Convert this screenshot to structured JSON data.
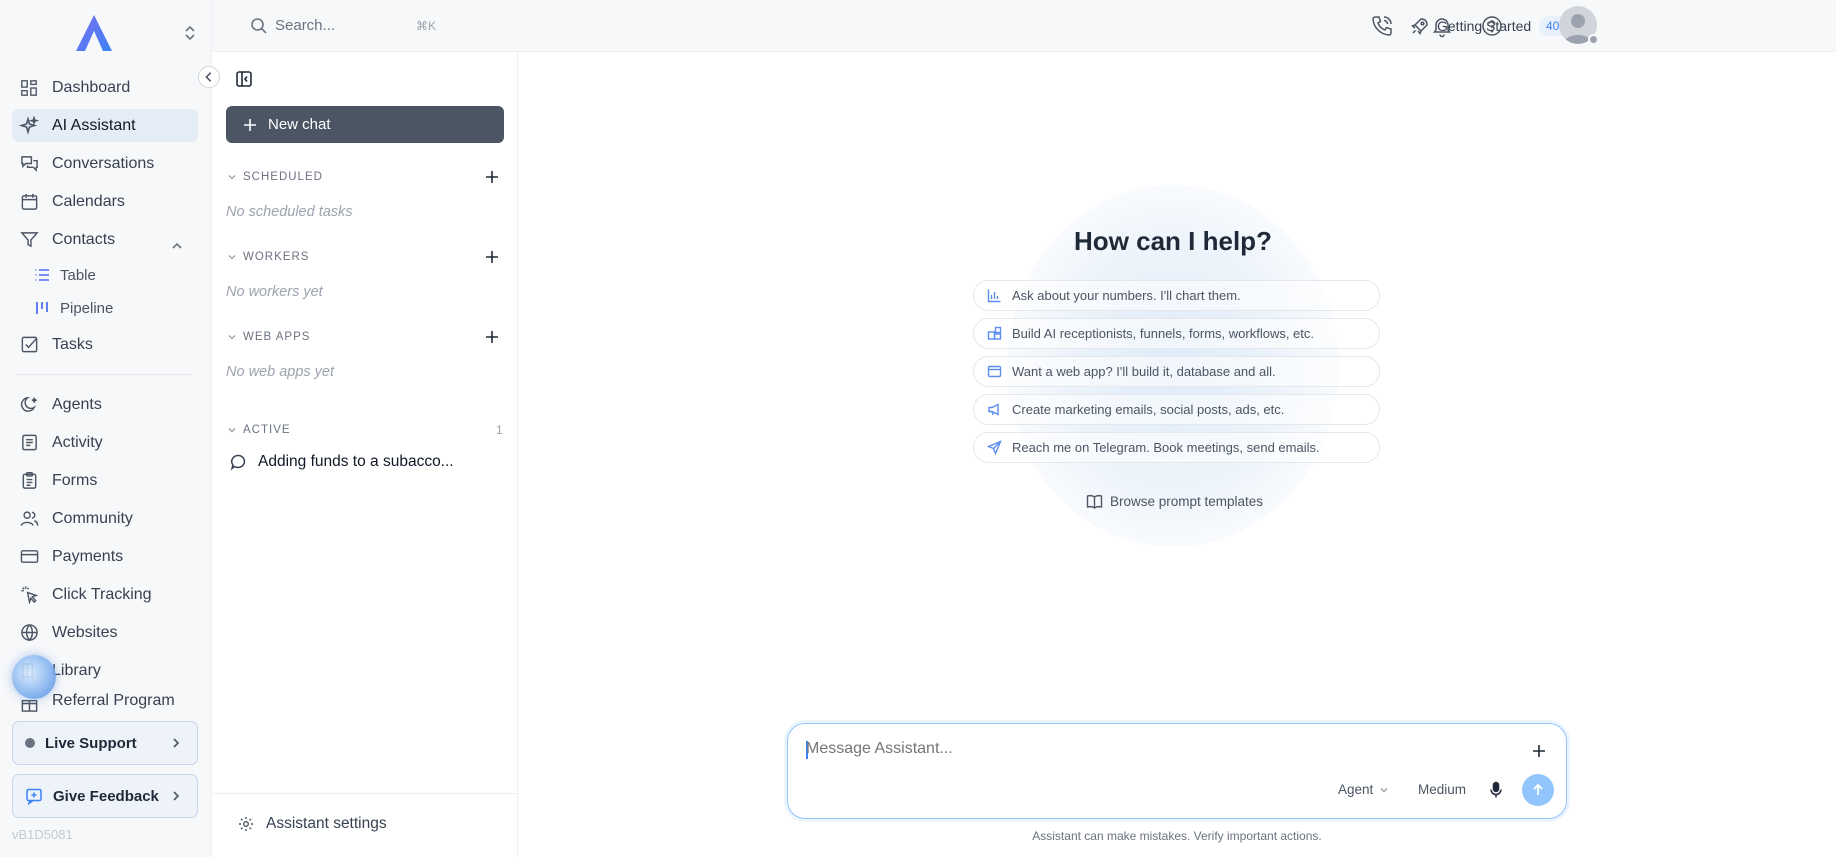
{
  "search": {
    "placeholder": "Search...",
    "shortcut": "⌘K"
  },
  "topbar": {
    "getting_started_label": "Getting Started",
    "getting_started_progress": "40%"
  },
  "nav": {
    "items": [
      {
        "label": "Dashboard"
      },
      {
        "label": "AI Assistant"
      },
      {
        "label": "Conversations"
      },
      {
        "label": "Calendars"
      },
      {
        "label": "Contacts"
      },
      {
        "label": "Tasks"
      },
      {
        "label": "Agents"
      },
      {
        "label": "Activity"
      },
      {
        "label": "Forms"
      },
      {
        "label": "Community"
      },
      {
        "label": "Payments"
      },
      {
        "label": "Click Tracking"
      },
      {
        "label": "Websites"
      },
      {
        "label": "Library"
      },
      {
        "label": "Referral Program"
      }
    ],
    "contacts_sub": [
      {
        "label": "Table"
      },
      {
        "label": "Pipeline"
      }
    ],
    "live_support": "Live Support",
    "give_feedback": "Give Feedback",
    "version": "vB1D5081"
  },
  "chat_sidebar": {
    "new_chat": "New chat",
    "sections": {
      "scheduled": {
        "title": "SCHEDULED",
        "empty": "No scheduled tasks"
      },
      "workers": {
        "title": "WORKERS",
        "empty": "No workers yet"
      },
      "web_apps": {
        "title": "WEB APPS",
        "empty": "No web apps yet"
      },
      "active": {
        "title": "ACTIVE",
        "count": "1"
      }
    },
    "active_chats": [
      {
        "title": "Adding funds to a subacco..."
      }
    ],
    "settings_label": "Assistant settings"
  },
  "main": {
    "title": "How can I help?",
    "prompts": [
      {
        "label": "Ask about your numbers. I'll chart them.",
        "icon": "bar-chart-icon"
      },
      {
        "label": "Build AI receptionists, funnels, forms, workflows, etc.",
        "icon": "blocks-icon"
      },
      {
        "label": "Want a web app? I'll build it, database and all.",
        "icon": "browser-window-icon"
      },
      {
        "label": "Create marketing emails, social posts, ads, etc.",
        "icon": "megaphone-icon"
      },
      {
        "label": "Reach me on Telegram. Book meetings, send emails.",
        "icon": "send-icon"
      }
    ],
    "browse_templates": "Browse prompt templates",
    "composer": {
      "placeholder": "Message Assistant...",
      "mode": "Agent",
      "effort": "Medium"
    },
    "disclaimer": "Assistant can make mistakes. Verify important actions."
  },
  "colors": {
    "accent": "#3b82f6",
    "active_nav_bg": "#e4ecf5",
    "new_chat_bg": "#4b5563",
    "composer_border": "#93c5fd"
  }
}
